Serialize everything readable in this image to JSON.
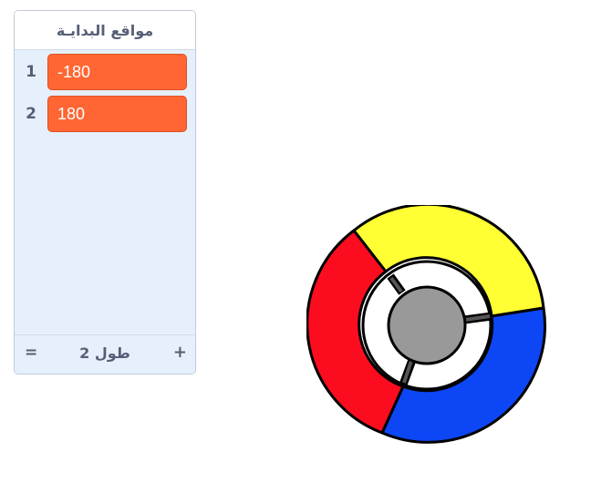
{
  "list": {
    "title": "مواقع البدايـة",
    "items": [
      {
        "index": "1",
        "value": "-180"
      },
      {
        "index": "2",
        "value": "180"
      }
    ],
    "footer": {
      "resize_symbol": "=",
      "length_label": "طول 2",
      "add_symbol": "+"
    },
    "colors": {
      "item_bg": "#ff6633",
      "panel_bg": "#e6f0fd"
    }
  },
  "wheel": {
    "segments": [
      {
        "color": "#ffff33",
        "name": "yellow"
      },
      {
        "color": "#0d47f5",
        "name": "blue"
      },
      {
        "color": "#fb0d1f",
        "name": "red"
      }
    ],
    "center_color": "#999999",
    "spoke_color": "#555555"
  }
}
